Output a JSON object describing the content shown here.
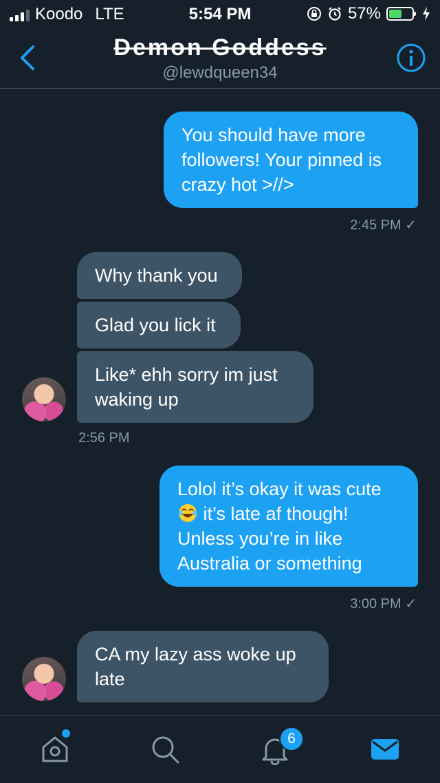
{
  "status_bar": {
    "carrier": "Koodo",
    "network": "LTE",
    "time": "5:54 PM",
    "battery_percent": "57%",
    "battery_level": 0.57,
    "battery_color": "#4cd964"
  },
  "header": {
    "title": "Demon Goddess",
    "handle": "@lewdqueen34",
    "back_icon": "chevron-left-icon",
    "info_icon": "info-icon"
  },
  "colors": {
    "background": "#15202b",
    "sent_bubble": "#1da1f2",
    "received_bubble": "#3d5466",
    "muted_text": "#8899a6"
  },
  "messages": [
    {
      "direction": "sent",
      "text": "You should have more followers! Your pinned is crazy hot >//>"
    },
    {
      "direction": "sent_stamp",
      "text": "2:45 PM"
    },
    {
      "direction": "received",
      "text": "Why thank you"
    },
    {
      "direction": "received",
      "text": "Glad you lick it"
    },
    {
      "direction": "received",
      "text": "Like* ehh sorry im just waking up"
    },
    {
      "direction": "received_stamp",
      "text": "2:56 PM"
    },
    {
      "direction": "sent",
      "text_before_emoji": "Lolol it’s okay it was cute",
      "emoji": "face-with-tears-of-joy",
      "text_after_emoji": " it’s late af though! Unless you’re in like Australia or something"
    },
    {
      "direction": "sent_stamp",
      "text": "3:00 PM"
    },
    {
      "direction": "received",
      "text": "CA my lazy ass woke up late"
    }
  ],
  "tab_bar": {
    "home_icon": "home-icon",
    "search_icon": "search-icon",
    "notifications_icon": "bell-icon",
    "notifications_badge": "6",
    "messages_icon": "envelope-icon",
    "active_tab": "messages"
  }
}
